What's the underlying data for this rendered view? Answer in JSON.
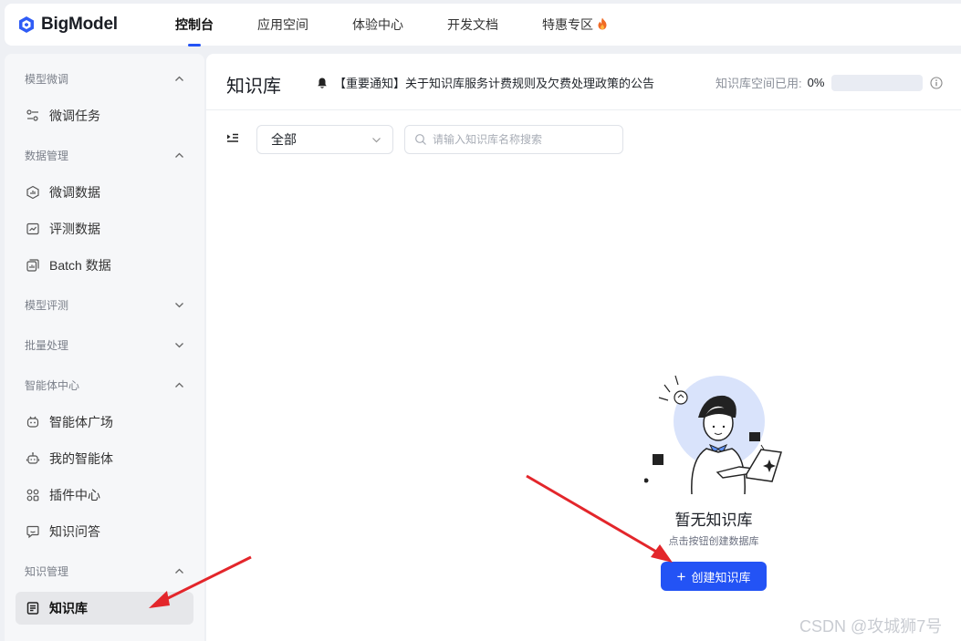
{
  "header": {
    "logo_text": "BigModel",
    "nav": [
      {
        "label": "控制台",
        "active": true
      },
      {
        "label": "应用空间"
      },
      {
        "label": "体验中心"
      },
      {
        "label": "开发文档"
      },
      {
        "label": "特惠专区"
      }
    ]
  },
  "sidebar": {
    "sections": [
      {
        "title": "模型微调",
        "expanded": true,
        "items": [
          {
            "label": "微调任务",
            "icon": "sliders-icon"
          }
        ]
      },
      {
        "title": "数据管理",
        "expanded": true,
        "items": [
          {
            "label": "微调数据",
            "icon": "hexagon-data-icon"
          },
          {
            "label": "评测数据",
            "icon": "chart-icon"
          },
          {
            "label": "Batch 数据",
            "icon": "batch-icon"
          }
        ]
      },
      {
        "title": "模型评测",
        "expanded": false,
        "items": []
      },
      {
        "title": "批量处理",
        "expanded": false,
        "items": []
      },
      {
        "title": "智能体中心",
        "expanded": true,
        "items": [
          {
            "label": "智能体广场",
            "icon": "robot-icon"
          },
          {
            "label": "我的智能体",
            "icon": "bot-icon"
          },
          {
            "label": "插件中心",
            "icon": "plugin-icon"
          },
          {
            "label": "知识问答",
            "icon": "qa-icon"
          }
        ]
      },
      {
        "title": "知识管理",
        "expanded": true,
        "items": [
          {
            "label": "知识库",
            "icon": "book-icon",
            "active": true
          }
        ]
      }
    ]
  },
  "main": {
    "title": "知识库",
    "notice": "【重要通知】关于知识库服务计费规则及欠费处理政策的公告",
    "usage_label": "知识库空间已用:",
    "usage_value": "0%",
    "usage_fraction": 0,
    "filter_selected": "全部",
    "search_placeholder": "请输入知识库名称搜索",
    "empty_title": "暂无知识库",
    "empty_subtitle": "点击按钮创建数据库",
    "create_button": "创建知识库"
  },
  "watermark": "CSDN @攻城狮7号",
  "colors": {
    "accent": "#2353f5",
    "annotation_arrow": "#e3262b"
  }
}
